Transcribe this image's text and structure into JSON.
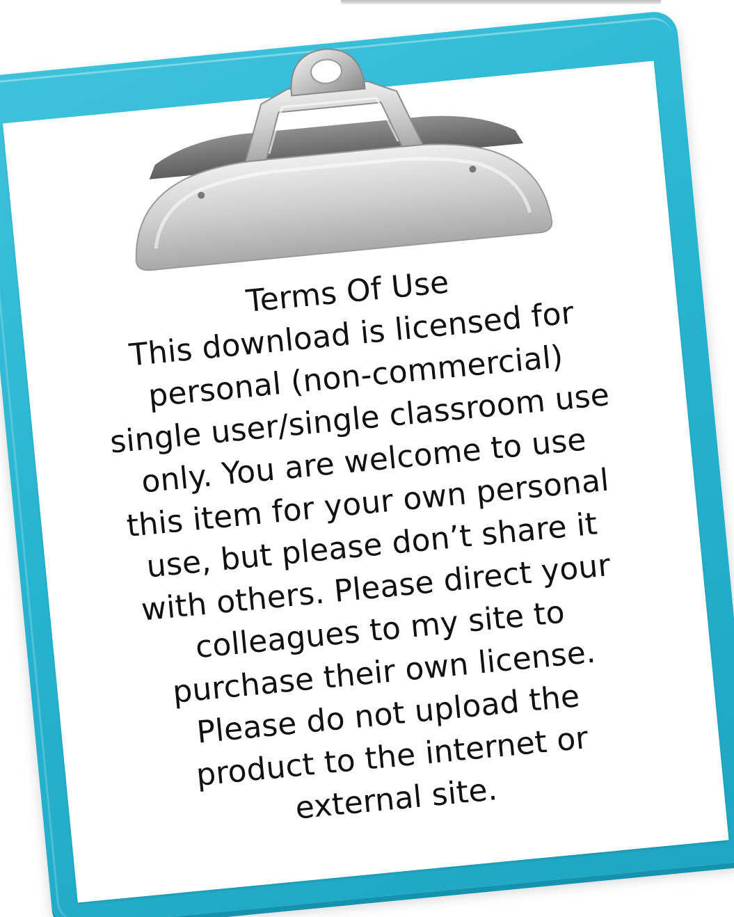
{
  "title": "Terms Of Use",
  "body_lines": [
    "This download is licensed for",
    "personal (non-commercial)",
    "single user/single classroom use",
    "only. You are welcome to use",
    "this item for your own personal",
    "use, but please don’t share it",
    "with others. Please direct your",
    "colleagues to my site to",
    "purchase their own license.",
    "Please do not upload the",
    "product to the internet or",
    "external site."
  ],
  "colors": {
    "board": "#27b4d0",
    "paper": "#ffffff",
    "clip": "#c4c4c4",
    "text": "#111111"
  },
  "icons": {
    "clip": "clipboard-clip-icon"
  }
}
